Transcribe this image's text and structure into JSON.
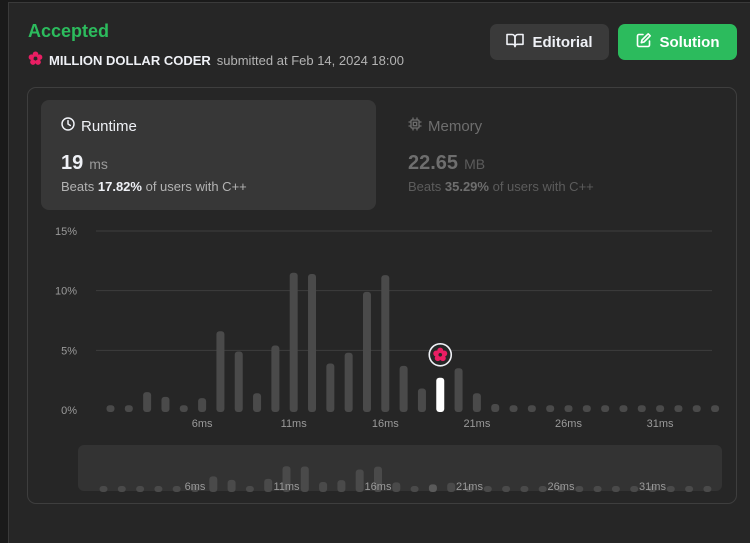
{
  "header": {
    "status": "Accepted",
    "submitter_name": "MILLION DOLLAR CODER",
    "submitted_text": "submitted at Feb 14, 2024 18:00",
    "editorial_label": "Editorial",
    "solution_label": "Solution"
  },
  "runtime": {
    "title": "Runtime",
    "value": "19",
    "unit": "ms",
    "beats_prefix": "Beats",
    "beats_pct": "17.82%",
    "beats_suffix": "of users with C++"
  },
  "memory": {
    "title": "Memory",
    "value": "22.65",
    "unit": "MB",
    "beats_prefix": "Beats",
    "beats_pct": "35.29%",
    "beats_suffix": "of users with C++"
  },
  "colors": {
    "accepted": "#2cbb5d",
    "bar": "#4a4a4a",
    "highlight_bar": "#ffffff",
    "avatar": "#e91e63"
  },
  "chart_data": {
    "type": "bar",
    "x_unit": "ms",
    "x": [
      1,
      2,
      3,
      4,
      5,
      6,
      7,
      8,
      9,
      10,
      11,
      12,
      13,
      14,
      15,
      16,
      17,
      18,
      19,
      20,
      21,
      22,
      23,
      24,
      25,
      26,
      27,
      28,
      29,
      30,
      31,
      32,
      33,
      34
    ],
    "values": [
      0.4,
      0.4,
      1.5,
      1.1,
      0.4,
      1.0,
      6.6,
      4.9,
      1.4,
      5.4,
      11.5,
      11.4,
      3.9,
      4.8,
      9.9,
      11.3,
      3.7,
      1.8,
      2.7,
      3.5,
      1.4,
      0.5,
      0.4,
      0.4,
      0.4,
      0.4,
      0.4,
      0.4,
      0.4,
      0.4,
      0.4,
      0.4,
      0.4,
      0.4
    ],
    "highlight_x": 19,
    "y_ticks": [
      "15%",
      "10%",
      "5%",
      "0%"
    ],
    "y_tick_values": [
      15,
      10,
      5,
      0
    ],
    "ylim": [
      0,
      15
    ],
    "x_ticks": [
      "6ms",
      "11ms",
      "16ms",
      "21ms",
      "26ms",
      "31ms"
    ],
    "x_tick_values": [
      6,
      11,
      16,
      21,
      26,
      31
    ],
    "grid": true
  }
}
